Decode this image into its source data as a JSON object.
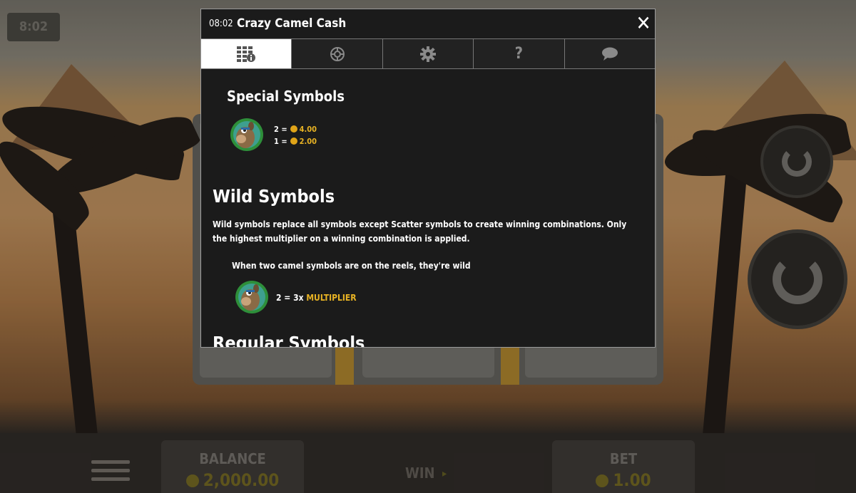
{
  "background": {
    "time_display": "8:02",
    "balance": {
      "label": "BALANCE",
      "value": "2,000.00"
    },
    "win": {
      "label": "WIN"
    },
    "bet": {
      "label": "BET",
      "value": "1.00"
    }
  },
  "modal": {
    "time": "08:02",
    "title": "Crazy Camel Cash",
    "close_icon": "close-icon",
    "tabs": [
      {
        "name": "paytable",
        "icon": "paytable-icon",
        "active": true
      },
      {
        "name": "game-rules",
        "icon": "rules-icon",
        "active": false
      },
      {
        "name": "settings",
        "icon": "gear-icon",
        "active": false
      },
      {
        "name": "help",
        "icon": "question-icon",
        "active": false,
        "glyph": "?"
      },
      {
        "name": "chat",
        "icon": "chat-bubble-icon",
        "active": false
      }
    ],
    "special_symbols": {
      "title": "Special Symbols",
      "symbol_icon": "camel-scatter-icon",
      "payouts": [
        {
          "count": "2 =",
          "value": "4.00"
        },
        {
          "count": "1 =",
          "value": "2.00"
        }
      ]
    },
    "wild_symbols": {
      "title": "Wild Symbols",
      "description": "Wild symbols replace all symbols except Scatter symbols to create winning combinations. Only the highest multiplier on a winning combination is applied.",
      "note": "When two camel symbols are on the reels, they're wild",
      "symbol_icon": "camel-wild-icon",
      "multiplier_count": "2 = 3x",
      "multiplier_label": "MULTIPLIER"
    },
    "regular_symbols": {
      "title": "Regular Symbols"
    }
  },
  "colors": {
    "accent_gold": "#e8b324",
    "modal_bg": "#1b1b1b",
    "tab_active_bg": "#ffffff"
  }
}
